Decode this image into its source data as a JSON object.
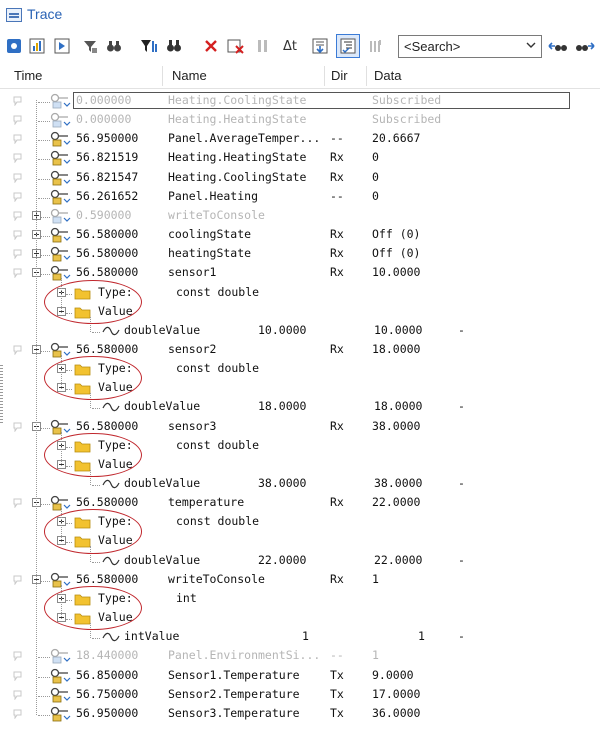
{
  "window": {
    "title": "Trace"
  },
  "search": {
    "placeholder": "<Search>"
  },
  "columns": {
    "time": "Time",
    "name": "Name",
    "dir": "Dir",
    "data": "Data"
  },
  "rows": [
    {
      "time": "0.000000",
      "name": "Heating.CoolingState",
      "dir": "",
      "data": "Subscribed",
      "gray": true
    },
    {
      "time": "0.000000",
      "name": "Heating.HeatingState",
      "dir": "",
      "data": "Subscribed",
      "gray": true
    },
    {
      "time": "56.950000",
      "name": "Panel.AverageTemper...",
      "dir": "--",
      "data": "20.6667"
    },
    {
      "time": "56.821519",
      "name": "Heating.HeatingState",
      "dir": "Rx",
      "data": "0"
    },
    {
      "time": "56.821547",
      "name": "Heating.CoolingState",
      "dir": "Rx",
      "data": "0"
    },
    {
      "time": "56.261652",
      "name": "Panel.Heating",
      "dir": "--",
      "data": "0"
    },
    {
      "time": "0.590000",
      "name": "writeToConsole",
      "dir": "",
      "data": "",
      "gray": true
    },
    {
      "time": "56.580000",
      "name": "coolingState",
      "dir": "Rx",
      "data": "Off (0)"
    },
    {
      "time": "56.580000",
      "name": "heatingState",
      "dir": "Rx",
      "data": "Off (0)"
    },
    {
      "time": "56.580000",
      "name": "sensor1",
      "dir": "Rx",
      "data": "10.0000"
    },
    {
      "label": "Type:",
      "value": "const double"
    },
    {
      "label": "Value",
      "value": ""
    },
    {
      "label": "doubleValue",
      "v1": "10.0000",
      "v2": "10.0000",
      "v3": "-"
    },
    {
      "time": "56.580000",
      "name": "sensor2",
      "dir": "Rx",
      "data": "18.0000"
    },
    {
      "label": "Type:",
      "value": "const double"
    },
    {
      "label": "Value",
      "value": ""
    },
    {
      "label": "doubleValue",
      "v1": "18.0000",
      "v2": "18.0000",
      "v3": "-"
    },
    {
      "time": "56.580000",
      "name": "sensor3",
      "dir": "Rx",
      "data": "38.0000"
    },
    {
      "label": "Type:",
      "value": "const double"
    },
    {
      "label": "Value",
      "value": ""
    },
    {
      "label": "doubleValue",
      "v1": "38.0000",
      "v2": "38.0000",
      "v3": "-"
    },
    {
      "time": "56.580000",
      "name": "temperature",
      "dir": "Rx",
      "data": "22.0000"
    },
    {
      "label": "Type:",
      "value": "const double"
    },
    {
      "label": "Value",
      "value": ""
    },
    {
      "label": "doubleValue",
      "v1": "22.0000",
      "v2": "22.0000",
      "v3": "-"
    },
    {
      "time": "56.580000",
      "name": "writeToConsole",
      "dir": "Rx",
      "data": "1"
    },
    {
      "label": "Type:",
      "value": "int"
    },
    {
      "label": "Value",
      "value": ""
    },
    {
      "label": "intValue",
      "v1": "1",
      "v2": "1",
      "v3": "-"
    },
    {
      "time": "18.440000",
      "name": "Panel.EnvironmentSi...",
      "dir": "--",
      "data": "1",
      "gray": true
    },
    {
      "time": "56.850000",
      "name": "Sensor1.Temperature",
      "dir": "Tx",
      "data": "9.0000"
    },
    {
      "time": "56.750000",
      "name": "Sensor2.Temperature",
      "dir": "Tx",
      "data": "17.0000"
    },
    {
      "time": "56.950000",
      "name": "Sensor3.Temperature",
      "dir": "Tx",
      "data": "36.0000"
    }
  ],
  "colors": {
    "accent": "#2a63b5",
    "highlight": "#c0272d"
  }
}
